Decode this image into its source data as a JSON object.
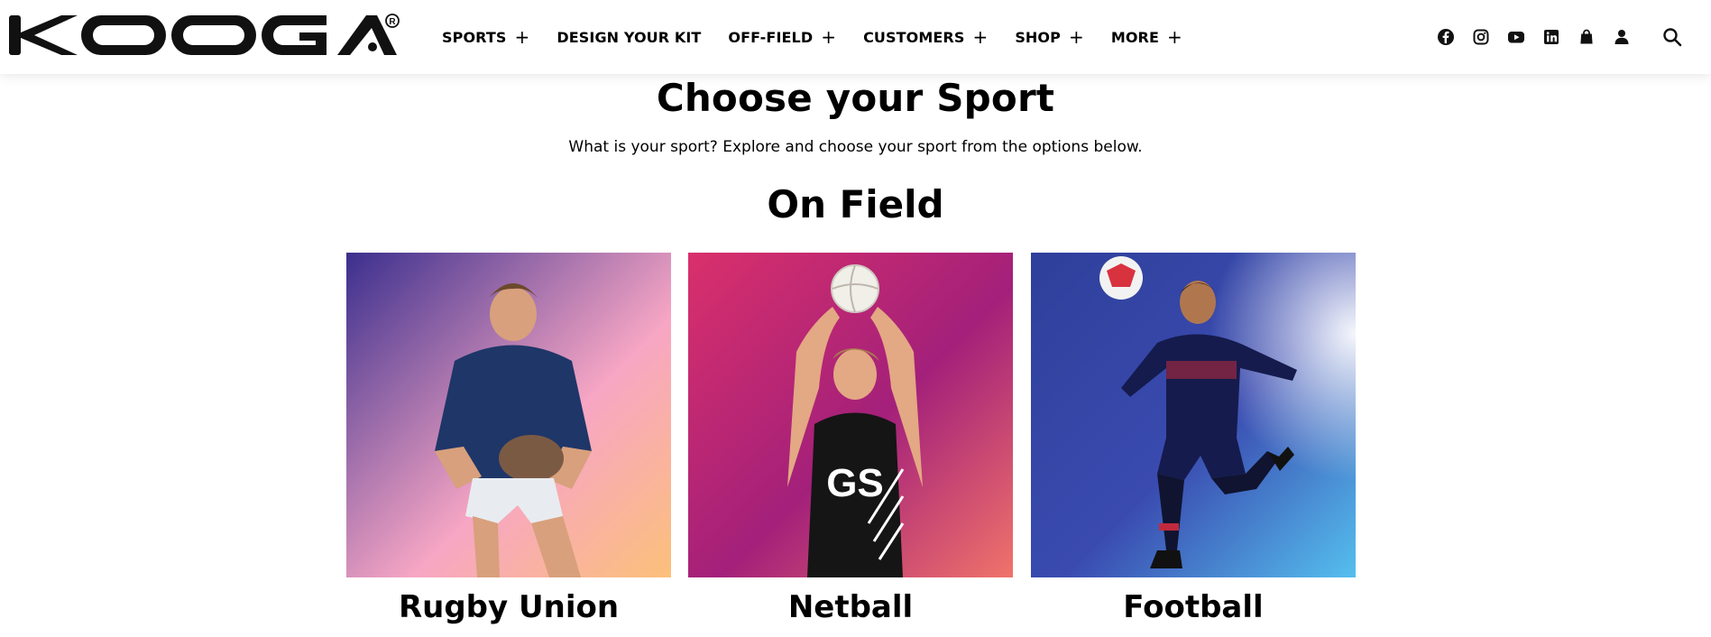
{
  "brand": {
    "name": "KOOGA"
  },
  "nav": {
    "items": [
      {
        "label": "SPORTS",
        "expandable": true
      },
      {
        "label": "DESIGN YOUR KIT",
        "expandable": false
      },
      {
        "label": "OFF-FIELD",
        "expandable": true
      },
      {
        "label": "CUSTOMERS",
        "expandable": true
      },
      {
        "label": "SHOP",
        "expandable": true
      },
      {
        "label": "MORE",
        "expandable": true
      }
    ],
    "plus_glyph": "+"
  },
  "header_icons": [
    "facebook-icon",
    "instagram-icon",
    "youtube-icon",
    "linkedin-icon",
    "shopping-bag-icon",
    "account-icon",
    "search-icon"
  ],
  "main": {
    "title": "Choose your Sport",
    "subtitle": "What is your sport? Explore and choose your sport from the options below.",
    "section_title": "On Field",
    "cards": [
      {
        "label": "Rugby Union",
        "colors": [
          "#3b2f8e",
          "#f7a6c4",
          "#fcc07a"
        ]
      },
      {
        "label": "Netball",
        "colors": [
          "#d9306b",
          "#a3207a",
          "#f0736a"
        ]
      },
      {
        "label": "Football",
        "colors": [
          "#2e3f9a",
          "#3a4bb0",
          "#55bfee"
        ]
      }
    ]
  }
}
